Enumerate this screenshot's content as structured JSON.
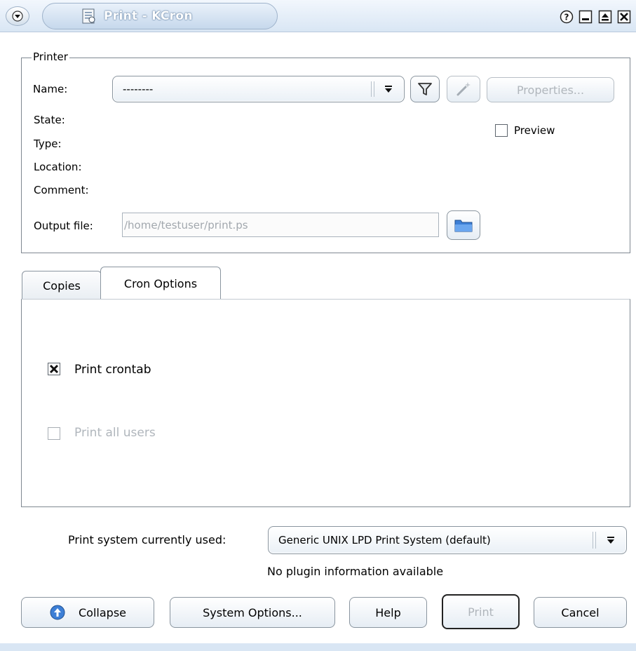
{
  "window": {
    "title": "Print - KCron",
    "controls": [
      "help",
      "minimize",
      "maximize",
      "close"
    ]
  },
  "printer": {
    "group_label": "Printer",
    "name_label": "Name:",
    "name_value": "--------",
    "properties_label": "Properties...",
    "state_label": "State:",
    "type_label": "Type:",
    "location_label": "Location:",
    "comment_label": "Comment:",
    "preview_label": "Preview",
    "preview_checked": false,
    "output_file_label": "Output file:",
    "output_file_value": "/home/testuser/print.ps"
  },
  "tabs": [
    {
      "label": "Copies",
      "active": false
    },
    {
      "label": "Cron Options",
      "active": true
    }
  ],
  "cron_options": {
    "print_crontab_label": "Print crontab",
    "print_crontab_checked": true,
    "print_all_users_label": "Print all users",
    "print_all_users_checked": false,
    "print_all_users_enabled": false
  },
  "print_system": {
    "label": "Print system currently used:",
    "value": "Generic UNIX LPD Print System (default)",
    "info": "No plugin information available"
  },
  "buttons": {
    "collapse": "Collapse",
    "system_options": "System Options...",
    "help": "Help",
    "print": "Print",
    "cancel": "Cancel"
  },
  "colors": {
    "titlebar_gradient_top": "#f2f7fd",
    "titlebar_gradient_bottom": "#d9e6f4",
    "accent_blue": "#3d7fd6",
    "disabled_text": "#b0b6bc"
  }
}
